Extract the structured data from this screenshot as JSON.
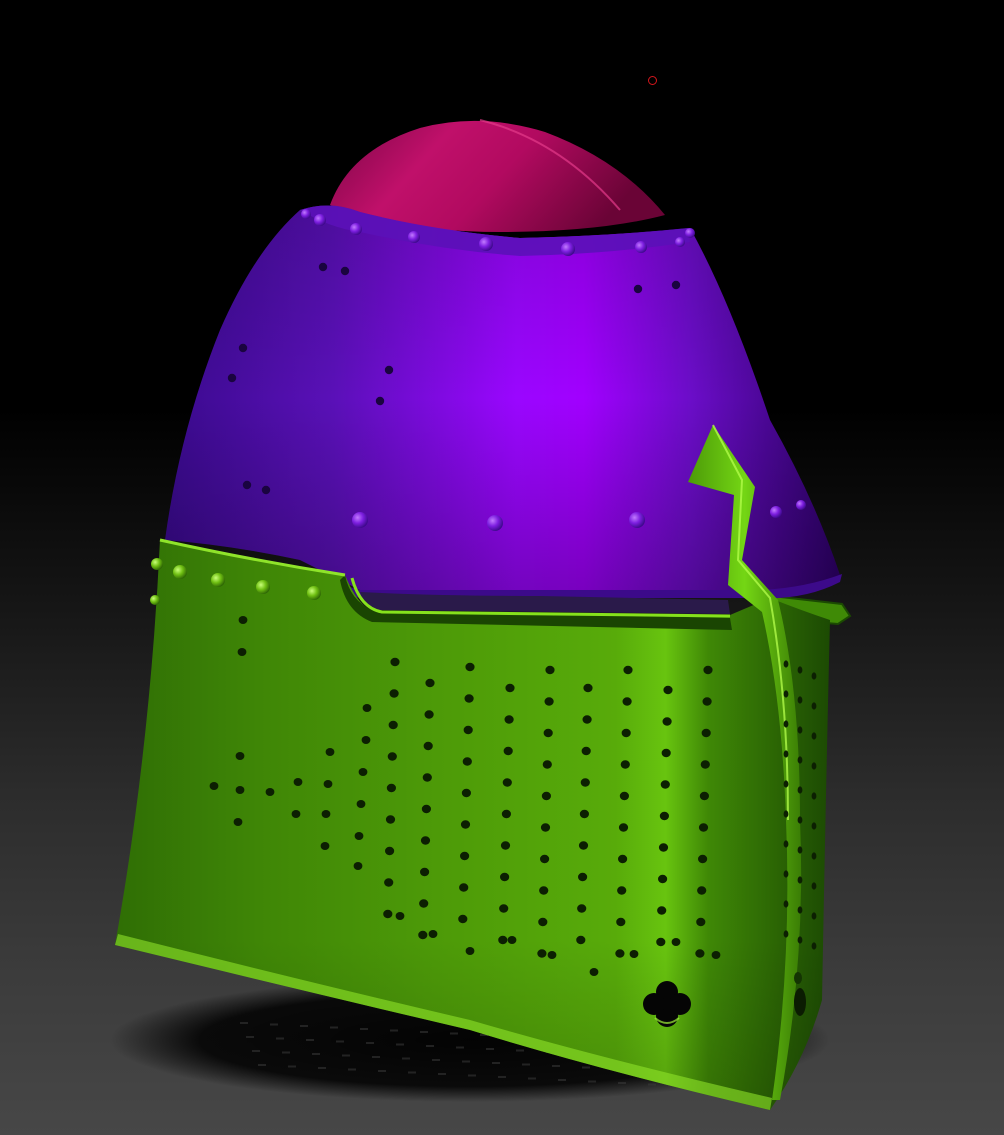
{
  "scene": {
    "subject": "great-helm",
    "background": "dark-gradient",
    "cursor_icon": "brush-cursor-circle-icon"
  },
  "colors": {
    "background_top": "#000000",
    "background_bottom": "#474747",
    "dome_cap": "#b10a63",
    "dome_cap_highlight": "#e0207f",
    "skull_plate": "#7a0fd6",
    "skull_plate_highlight": "#a600ff",
    "skull_plate_shadow": "#2d0068",
    "faceplate": "#4d9a08",
    "faceplate_highlight": "#6ecf12",
    "faceplate_shadow": "#163c02",
    "rivets_skull": "#8d2ff0",
    "rivets_face": "#8ee03a",
    "cursor": "#d4161c"
  },
  "parts": [
    "dome-cap",
    "skull-plate",
    "faceplate",
    "vertical-crest",
    "breath-holes",
    "cross-vent"
  ]
}
